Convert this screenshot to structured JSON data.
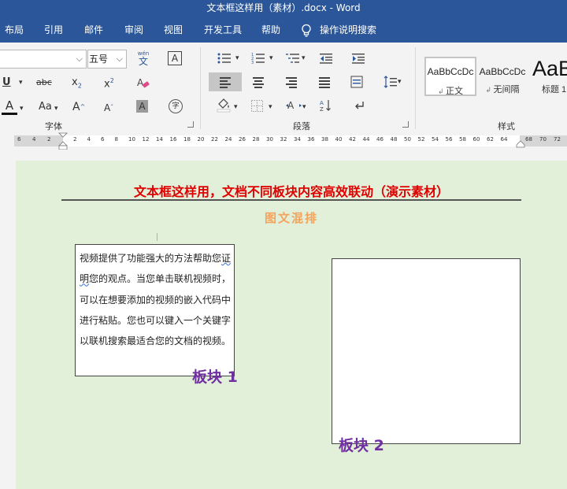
{
  "window": {
    "title": "文本框这样用（素材）.docx  -  Word"
  },
  "ribbon_tabs": [
    "布局",
    "引用",
    "邮件",
    "审阅",
    "视图",
    "开发工具",
    "帮助"
  ],
  "tell_me": "操作说明搜索",
  "font_group": {
    "label": "字体",
    "font_name": "",
    "font_size": "五号",
    "phonetic_top": "wén",
    "phonetic_bottom": "文",
    "border_char": "A",
    "underline": "U",
    "strikethrough": "abc",
    "subscript_base": "x",
    "subscript_sub": "2",
    "superscript_base": "x",
    "superscript_sup": "2",
    "font_color": "A",
    "change_case": "Aa",
    "grow": "A",
    "shrink": "A",
    "shading": "A",
    "enclose": "字"
  },
  "paragraph_group": {
    "label": "段落"
  },
  "styles_group": {
    "label": "样式",
    "items": [
      {
        "sample": "AaBbCcDc",
        "name": "正文"
      },
      {
        "sample": "AaBbCcDc",
        "name": "无间隔"
      },
      {
        "sample": "AaB",
        "name": "标题 1"
      }
    ]
  },
  "ruler": {
    "left_numbers": [
      "6",
      "4",
      "2"
    ],
    "numbers": [
      "2",
      "4",
      "6",
      "8",
      "10",
      "12",
      "14",
      "16",
      "18",
      "20",
      "22",
      "24",
      "26",
      "28",
      "30",
      "32",
      "34",
      "36",
      "38",
      "40",
      "42",
      "44",
      "46",
      "48",
      "50",
      "52",
      "54",
      "56",
      "58",
      "60",
      "62",
      "64"
    ],
    "right_numbers": [
      "68",
      "70",
      "72"
    ]
  },
  "document": {
    "heading": "文本框这样用，文档不同板块内容高效联动（演示素材）",
    "subtitle": "图文混排",
    "textbox1": {
      "before": "视频提供了功能强大的方法帮助您",
      "squiggle": "证明",
      "after": "您的观点。当您单击联机视频时，可以在想要添加的视频的嵌入代码中进行粘贴。您也可以键入一个关键字以联机搜索最适合您的文档的视频。"
    },
    "block1_label": "板块 1",
    "block2_label": "板块 2"
  },
  "colors": {
    "accent": "#2b579a",
    "heading": "#e00000",
    "subtitle": "#f4a35a",
    "block_label": "#7030a0",
    "page": "#e2efd9"
  }
}
